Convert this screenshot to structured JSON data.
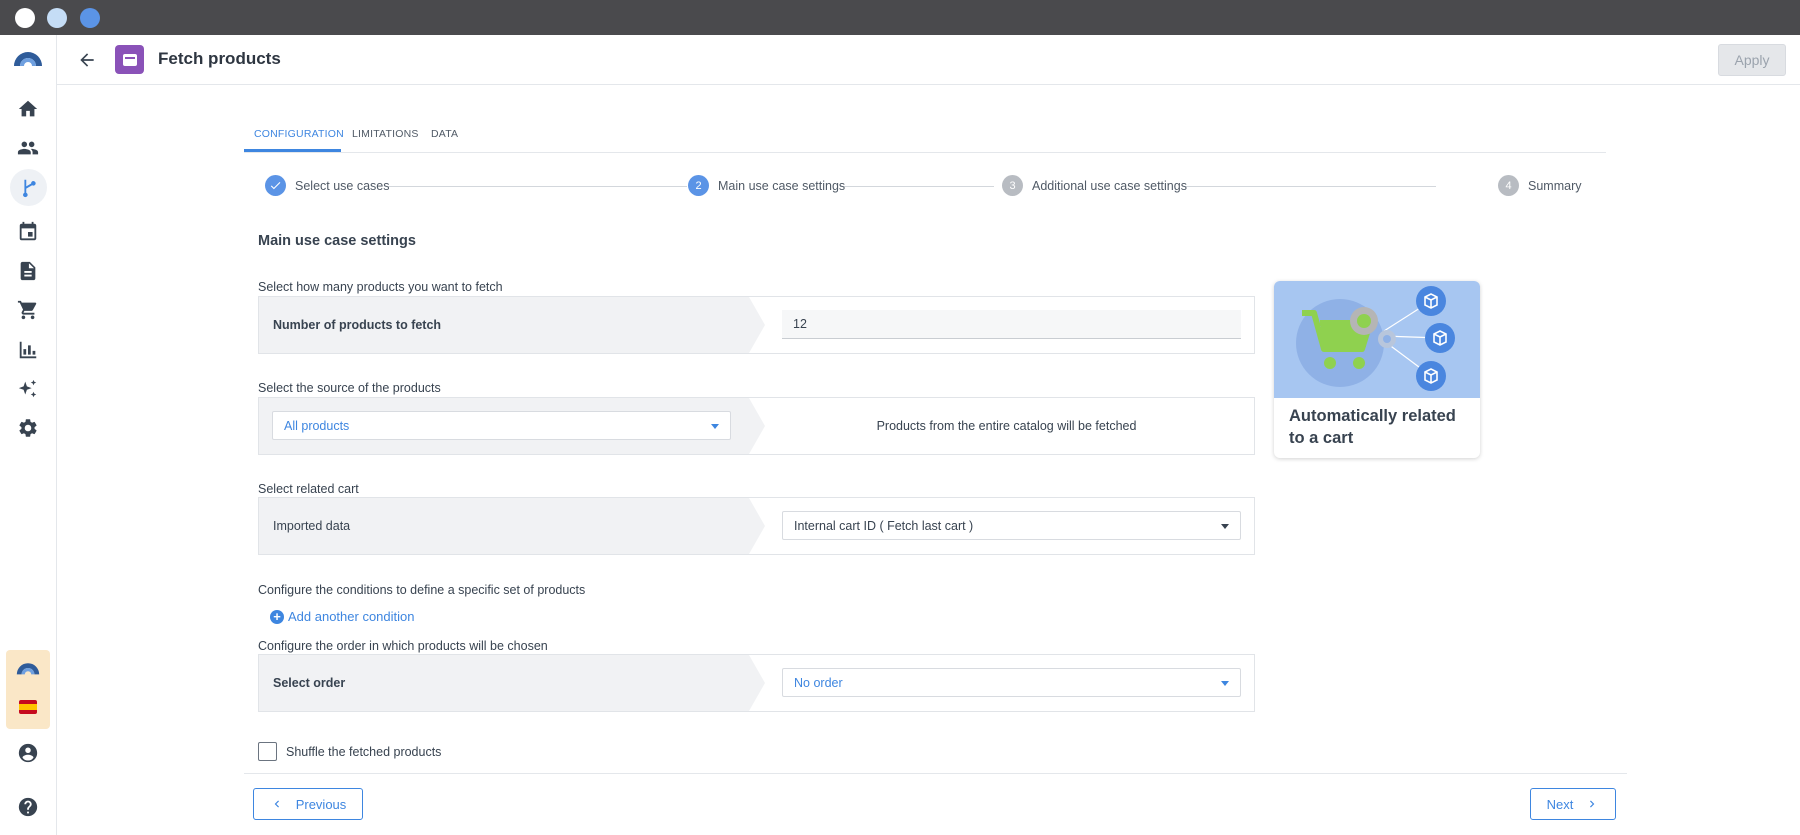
{
  "window": {
    "dots": [
      "close",
      "minimize",
      "maximize"
    ]
  },
  "sidebar": {
    "items": [
      {
        "icon": "logo-arc-icon"
      },
      {
        "icon": "home-icon"
      },
      {
        "icon": "people-icon"
      },
      {
        "icon": "flow-icon",
        "active": true
      },
      {
        "icon": "calendar-icon"
      },
      {
        "icon": "document-icon"
      },
      {
        "icon": "cart-icon"
      },
      {
        "icon": "bar-chart-icon"
      },
      {
        "icon": "sparkle-icon"
      },
      {
        "icon": "gear-icon"
      },
      {
        "icon": "brand-logo-icon"
      },
      {
        "icon": "spain-flag-icon"
      },
      {
        "icon": "account-icon"
      },
      {
        "icon": "help-icon"
      }
    ]
  },
  "header": {
    "title": "Fetch products",
    "apply_label": "Apply",
    "badge_color": "#8a52b8"
  },
  "tabs": [
    {
      "label": "CONFIGURATION",
      "active": true
    },
    {
      "label": "LIMITATIONS",
      "active": false
    },
    {
      "label": "DATA",
      "active": false
    }
  ],
  "stepper": {
    "steps": [
      {
        "number": "1",
        "label": "Select use cases",
        "state": "done"
      },
      {
        "number": "2",
        "label": "Main use case settings",
        "state": "current"
      },
      {
        "number": "3",
        "label": "Additional use case settings",
        "state": "todo"
      },
      {
        "number": "4",
        "label": "Summary",
        "state": "todo"
      }
    ]
  },
  "main": {
    "section_title": "Main use case settings",
    "count": {
      "label": "Select how many products you want to fetch",
      "row_label": "Number of products to fetch",
      "value": "12"
    },
    "source": {
      "label": "Select the source of the products",
      "selected": "All products",
      "note": "Products from the entire catalog will be fetched"
    },
    "cart": {
      "label": "Select related cart",
      "row_label": "Imported data",
      "selected": "Internal cart ID ( Fetch last cart )"
    },
    "conditions": {
      "label": "Configure the conditions to define a specific set of products",
      "add_label": "Add another condition"
    },
    "order": {
      "label": "Configure the order in which products will be chosen",
      "row_label": "Select order",
      "selected": "No order"
    },
    "shuffle": {
      "label": "Shuffle the fetched products",
      "checked": false
    }
  },
  "card": {
    "title": "Automatically related to a cart",
    "image_color": "#a7c6f1"
  },
  "footer": {
    "previous_label": "Previous",
    "next_label": "Next"
  },
  "colors": {
    "accent": "#3e86e0",
    "step_done": "#5b94e6",
    "step_todo": "#b8bcc2"
  }
}
